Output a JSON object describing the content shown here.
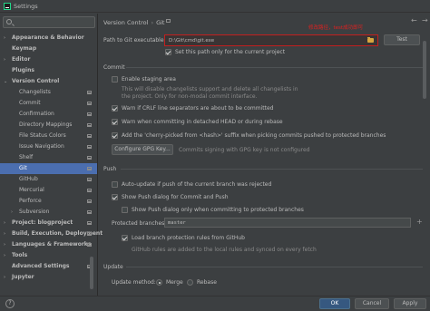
{
  "window": {
    "title": "Settings"
  },
  "sidebar": {
    "search_placeholder": "",
    "items": [
      {
        "label": "Appearance & Behavior",
        "level": 0,
        "bold": true,
        "chevron": "›"
      },
      {
        "label": "Keymap",
        "level": 0,
        "bold": true,
        "chevron": ""
      },
      {
        "label": "Editor",
        "level": 0,
        "bold": true,
        "chevron": "›"
      },
      {
        "label": "Plugins",
        "level": 0,
        "bold": true,
        "chevron": ""
      },
      {
        "label": "Version Control",
        "level": 0,
        "bold": true,
        "chevron": "⌄"
      },
      {
        "label": "Changelists",
        "level": 1,
        "bold": false,
        "chevron": ""
      },
      {
        "label": "Commit",
        "level": 1,
        "bold": false,
        "chevron": ""
      },
      {
        "label": "Confirmation",
        "level": 1,
        "bold": false,
        "chevron": ""
      },
      {
        "label": "Directory Mappings",
        "level": 1,
        "bold": false,
        "chevron": ""
      },
      {
        "label": "File Status Colors",
        "level": 1,
        "bold": false,
        "chevron": ""
      },
      {
        "label": "Issue Navigation",
        "level": 1,
        "bold": false,
        "chevron": ""
      },
      {
        "label": "Shelf",
        "level": 1,
        "bold": false,
        "chevron": ""
      },
      {
        "label": "Git",
        "level": 1,
        "bold": false,
        "chevron": "",
        "selected": true
      },
      {
        "label": "GitHub",
        "level": 1,
        "bold": false,
        "chevron": ""
      },
      {
        "label": "Mercurial",
        "level": 1,
        "bold": false,
        "chevron": ""
      },
      {
        "label": "Perforce",
        "level": 1,
        "bold": false,
        "chevron": ""
      },
      {
        "label": "Subversion",
        "level": 1,
        "bold": false,
        "chevron": "›"
      },
      {
        "label": "Project: blogproject",
        "level": 0,
        "bold": true,
        "chevron": "›"
      },
      {
        "label": "Build, Execution, Deployment",
        "level": 0,
        "bold": true,
        "chevron": "›"
      },
      {
        "label": "Languages & Frameworks",
        "level": 0,
        "bold": true,
        "chevron": "›"
      },
      {
        "label": "Tools",
        "level": 0,
        "bold": true,
        "chevron": "›"
      },
      {
        "label": "Advanced Settings",
        "level": 0,
        "bold": true,
        "chevron": ""
      },
      {
        "label": "Jupyter",
        "level": 0,
        "bold": true,
        "chevron": "›"
      }
    ]
  },
  "breadcrumb": {
    "parent": "Version Control",
    "separator": "›",
    "current": "Git"
  },
  "annotation": "修改路径，test成功即可",
  "git": {
    "path_label": "Path to Git executable:",
    "path_value": "D:\\Git\\cmd\\git.exe",
    "test_button": "Test",
    "set_path_only_label": "Set this path only for the current project",
    "set_path_only_checked": true
  },
  "commit": {
    "section_title": "Commit",
    "staging_label": "Enable staging area",
    "staging_checked": false,
    "staging_help_1": "This will disable changelists support and delete all changelists in",
    "staging_help_2": "the project. Only for non-modal commit interface.",
    "crlf_label": "Warn if CRLF line separators are about to be committed",
    "crlf_checked": true,
    "detached_label": "Warn when committing in detached HEAD or during rebase",
    "detached_checked": true,
    "cherry_label": "Add the 'cherry-picked from <hash>' suffix when picking commits pushed to protected branches",
    "cherry_checked": true,
    "gpg_button": "Configure GPG Key...",
    "gpg_note": "Commits signing with GPG key is not configured"
  },
  "push": {
    "section_title": "Push",
    "auto_update_label": "Auto-update if push of the current branch was rejected",
    "auto_update_checked": false,
    "show_dialog_label": "Show Push dialog for Commit and Push",
    "show_dialog_checked": true,
    "protected_only_label": "Show Push dialog only when committing to protected branches",
    "protected_only_checked": false,
    "protected_branches_label": "Protected branches:",
    "protected_branches_value": "master",
    "load_rules_label": "Load branch protection rules from GitHub",
    "load_rules_checked": true,
    "load_rules_help": "GitHub rules are added to the local rules and synced on every fetch"
  },
  "update": {
    "section_title": "Update",
    "method_label": "Update method:",
    "options": [
      "Merge",
      "Rebase"
    ],
    "selected": "Merge"
  },
  "footer": {
    "help": "?",
    "ok": "OK",
    "cancel": "Cancel",
    "apply": "Apply"
  }
}
